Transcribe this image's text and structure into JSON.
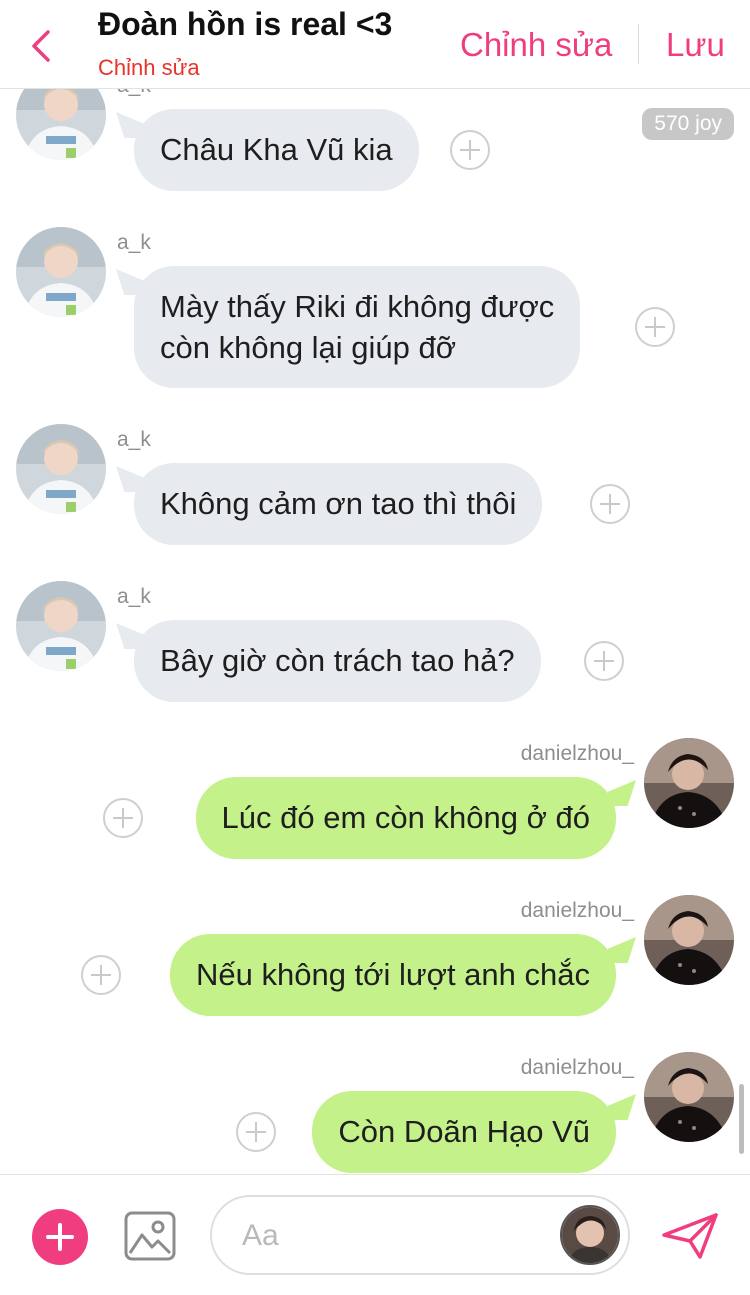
{
  "header": {
    "title": "Đoàn hồn is real <3",
    "subtitle": "Chỉnh sửa",
    "edit_label": "Chỉnh sửa",
    "save_label": "Lưu",
    "back_icon": "chevron-left-icon"
  },
  "joy_badge": "570 joy",
  "messages": [
    {
      "user": "a_k",
      "text": "Châu Kha Vũ kia",
      "side": "left"
    },
    {
      "user": "a_k",
      "text": "Mày thấy Riki đi không được\ncòn không lại giúp đỡ",
      "side": "left"
    },
    {
      "user": "a_k",
      "text": "Không cảm ơn tao thì thôi",
      "side": "left"
    },
    {
      "user": "a_k",
      "text": "Bây giờ còn trách tao hả?",
      "side": "left"
    },
    {
      "user": "danielzhou_",
      "text": "Lúc đó em còn không ở đó",
      "side": "right"
    },
    {
      "user": "danielzhou_",
      "text": "Nếu không tới lượt anh chắc",
      "side": "right"
    },
    {
      "user": "danielzhou_",
      "text": "Còn Doãn Hạo Vũ",
      "side": "right"
    }
  ],
  "composer": {
    "placeholder": "Aa",
    "add_icon": "plus-icon",
    "image_icon": "image-icon",
    "send_icon": "send-icon"
  },
  "colors": {
    "accent": "#f03d7f",
    "subtitle": "#e8332a",
    "bubble_left": "#e7eaee",
    "bubble_right": "#c4f18a"
  }
}
